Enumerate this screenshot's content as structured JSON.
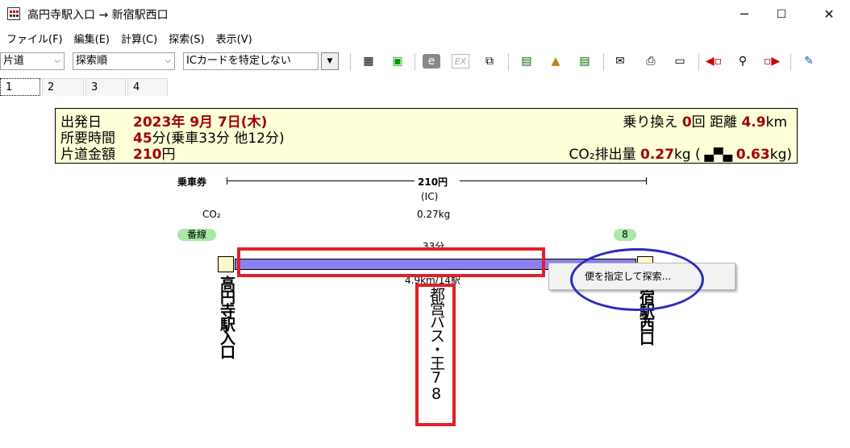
{
  "window": {
    "title": "高円寺駅入口 → 新宿駅西口",
    "minimize": "─",
    "maximize": "☐",
    "close": "✕"
  },
  "menu": [
    "ファイル(F)",
    "編集(E)",
    "計算(C)",
    "探索(S)",
    "表示(V)"
  ],
  "toolbar": {
    "fare_type": "片道",
    "sort_order": "探索順",
    "ic_card": "ICカードを特定しない",
    "dropdown_glyph": "▼"
  },
  "tabs": [
    "1",
    "2",
    "3",
    "4"
  ],
  "summary": {
    "date_label": "出発日",
    "date_value": "2023年 9月 7日(木)",
    "time_label": "所要時間",
    "time_value": "45",
    "time_unit": "分(乗車33分 他12分)",
    "fare_label": "片道金額",
    "fare_value": "210",
    "fare_unit": "円",
    "transfers_label": "乗り換え",
    "transfers_value": "0",
    "transfers_unit": "回",
    "distance_label": "距離",
    "distance_value": "4.9",
    "distance_unit": "km",
    "co2_label": "CO₂排出量",
    "co2_value": "0.27",
    "co2_unit": "kg (",
    "car_value": "0.63",
    "car_unit": "kg)"
  },
  "route": {
    "ticket_label": "乗車券",
    "ticket_fare": "210円",
    "ticket_type": "(IC)",
    "co2_label": "CO₂",
    "co2_value": "0.27kg",
    "platform_label": "番線",
    "platform_number": "8",
    "duration": "33分",
    "distance_stops": "4.9km/14駅",
    "origin": "高円寺駅入口",
    "line": "都営バス・王78",
    "destination": "新宿駅西口",
    "line_color": "#8a80f0"
  },
  "context_menu": {
    "item": "便を指定して探索..."
  }
}
